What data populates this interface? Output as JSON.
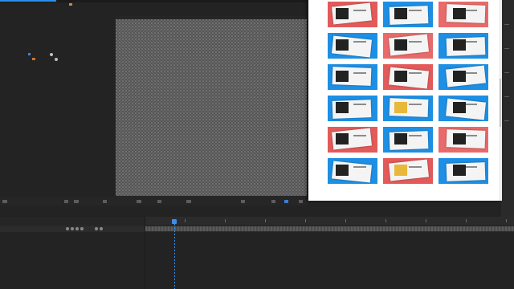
{
  "app": {
    "accent_color": "#2d8ceb",
    "top_label": "",
    "project": {
      "item_a": "",
      "item_b": ""
    }
  },
  "viewer": {
    "toolbar": {
      "zoom": "",
      "resolution": "",
      "timecode": ""
    }
  },
  "timeline": {
    "layer_name": "",
    "playhead_color": "#3b8df0"
  },
  "popup": {
    "rows": 6,
    "cols": 3,
    "thumbnails": [
      {
        "bg": "#e35a5a"
      },
      {
        "bg": "#1d8fe4"
      },
      {
        "bg": "#e86a6a"
      },
      {
        "bg": "#1d8fe4"
      },
      {
        "bg": "#e86a6a"
      },
      {
        "bg": "#1d8fe4"
      },
      {
        "bg": "#1d8fe4"
      },
      {
        "bg": "#e35a5a"
      },
      {
        "bg": "#1d8fe4"
      },
      {
        "bg": "#1d8fe4"
      },
      {
        "bg": "#1d8fe4"
      },
      {
        "bg": "#1d8fe4"
      },
      {
        "bg": "#e35a5a"
      },
      {
        "bg": "#1d8fe4"
      },
      {
        "bg": "#e86a6a"
      },
      {
        "bg": "#1d8fe4"
      },
      {
        "bg": "#e35a5a"
      },
      {
        "bg": "#1d8fe4"
      }
    ]
  }
}
